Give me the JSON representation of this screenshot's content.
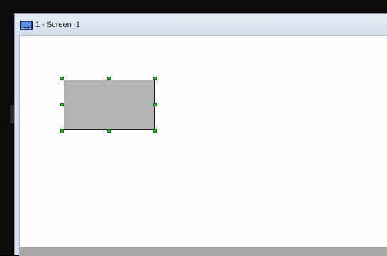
{
  "window": {
    "title": "1 - Screen_1"
  },
  "icons": {
    "title_icon": "screen-icon"
  },
  "colors": {
    "shape_fill": "#b4b4b4",
    "handle_color": "#22c422",
    "canvas_background": "#fdfdfd"
  }
}
